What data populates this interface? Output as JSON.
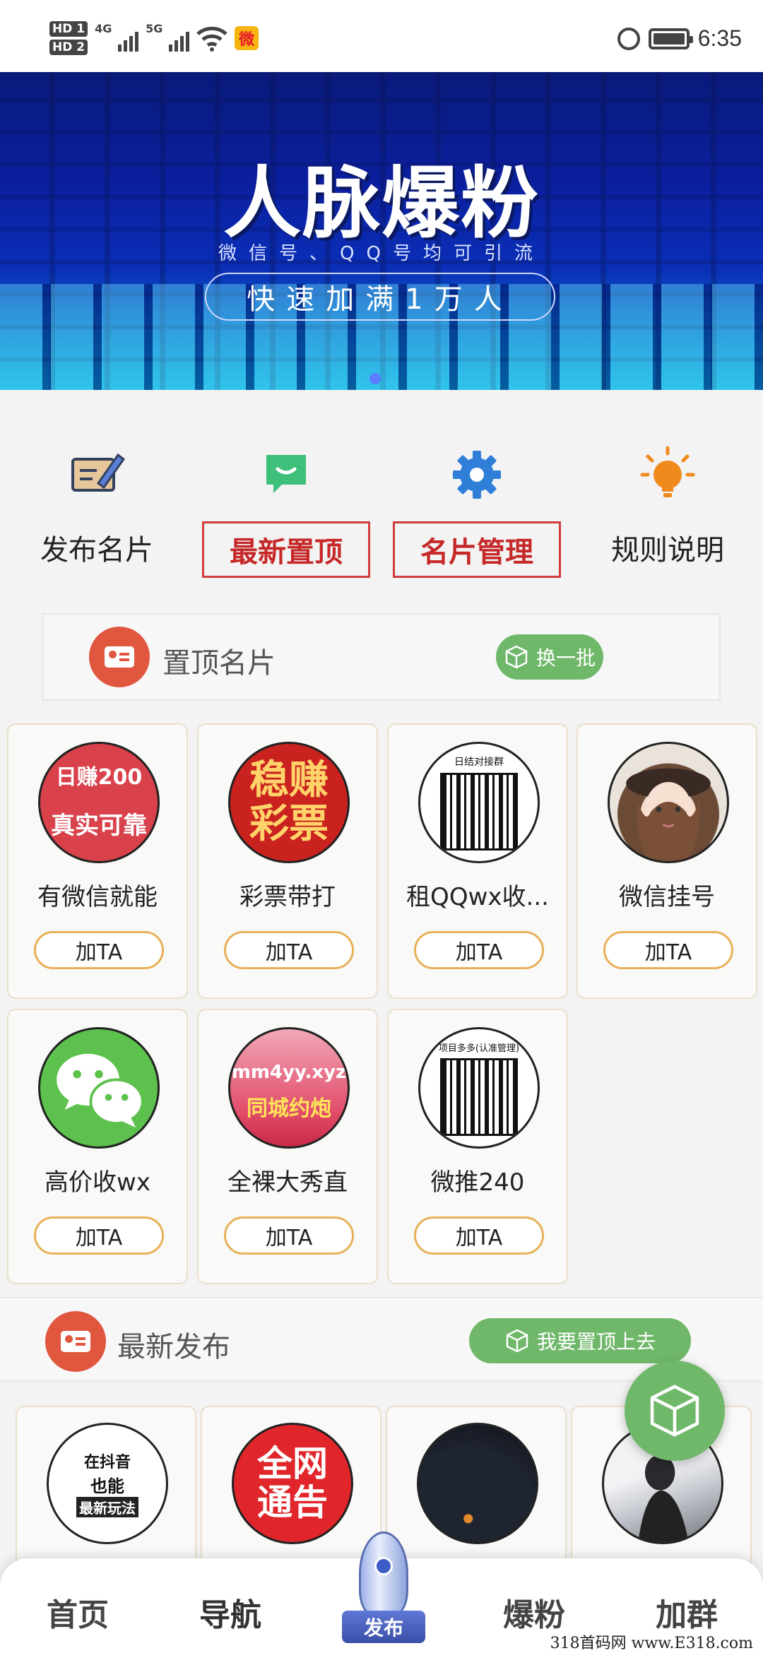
{
  "status_bar": {
    "hd1": "HD 1",
    "hd2": "HD 2",
    "net1": "4G",
    "net2": "5G",
    "time": "6:35",
    "icons": [
      "signal-icon",
      "wifi-icon",
      "weibo-icon",
      "alarm-icon",
      "battery-icon"
    ]
  },
  "banner": {
    "title": "人脉爆粉",
    "subtitle": "微信号、QQ号均可引流",
    "pill": "快速加满1万人",
    "colors": {
      "top": "#0a1a7a",
      "bottom": "#0aa6d8"
    }
  },
  "quick_menu": {
    "items": [
      {
        "label": "发布名片",
        "icon": "edit-card-icon"
      },
      {
        "label": "最新置顶",
        "icon": "message-icon"
      },
      {
        "label": "名片管理",
        "icon": "gear-icon"
      },
      {
        "label": "规则说明",
        "icon": "lightbulb-icon"
      }
    ]
  },
  "pinned": {
    "title": "置顶名片",
    "refresh_button": "换一批",
    "add_label": "加TA",
    "cards": [
      {
        "name": "有微信就能",
        "avatar_text": [
          "日赚200",
          "真实可靠"
        ]
      },
      {
        "name": "彩票带打",
        "avatar_text": [
          "稳赚",
          "彩票"
        ]
      },
      {
        "name": "租QQwx收...",
        "avatar_text": [
          "日结对接群"
        ]
      },
      {
        "name": "微信挂号",
        "avatar_text": []
      },
      {
        "name": "高价收wx",
        "avatar_text": []
      },
      {
        "name": "全裸大秀直",
        "avatar_text": [
          "mm4yy.xyz",
          "同城约炮"
        ]
      },
      {
        "name": "微推240",
        "avatar_text": [
          "项目多多(认准管理)"
        ]
      }
    ]
  },
  "latest": {
    "title": "最新发布",
    "pin_button": "我要置顶上去",
    "cards": [
      {
        "avatar_text": [
          "在抖音",
          "也能",
          "最新玩法"
        ]
      },
      {
        "avatar_text": [
          "全网",
          "通告"
        ]
      },
      {
        "avatar_text": []
      },
      {
        "avatar_text": []
      }
    ]
  },
  "bottom_nav": {
    "items": [
      "首页",
      "导航",
      "发布",
      "爆粉",
      "加群"
    ]
  },
  "watermark": "318首码网 www.E318.com",
  "colors": {
    "accent_green": "#6fb86a",
    "accent_red": "#d23c3c",
    "card_orange": "#e8b058"
  }
}
